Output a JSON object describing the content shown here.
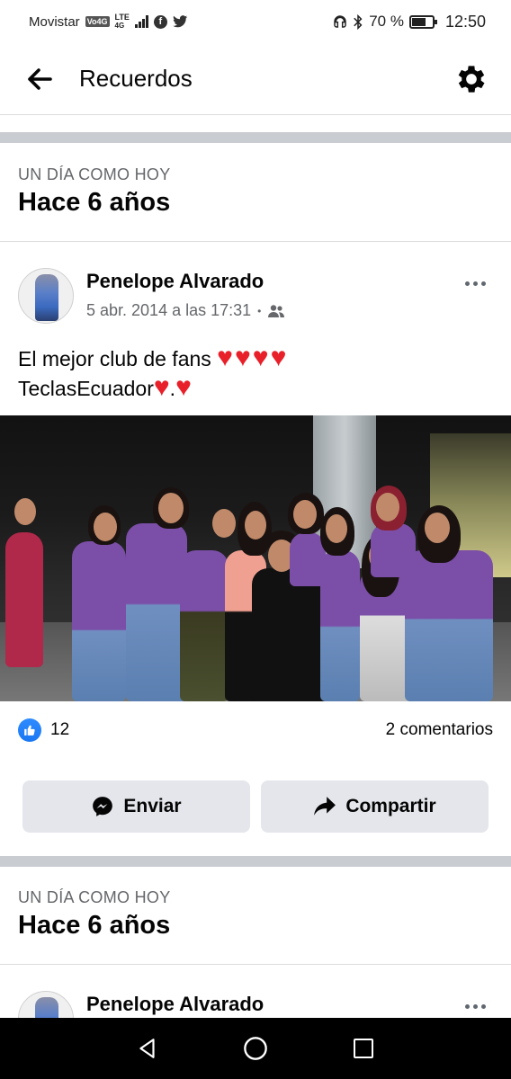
{
  "status_bar": {
    "carrier": "Movistar",
    "volte": "Vo4G",
    "lte_top": "LTE",
    "lte_bottom": "4G",
    "battery_percent_text": "70 %",
    "battery_level": 0.7,
    "time": "12:50",
    "icons": [
      "facebook-icon",
      "twitter-icon",
      "headset-icon",
      "bluetooth-icon",
      "battery-icon"
    ]
  },
  "header": {
    "title": "Recuerdos",
    "back_icon": "back-arrow-icon",
    "settings_icon": "gear-icon"
  },
  "memories": [
    {
      "kicker": "UN DÍA COMO HOY",
      "title": "Hace 6 años",
      "post": {
        "author": "Penelope Alvarado",
        "date": "5 abr. 2014 a las 17:31",
        "separator": "•",
        "audience_icon": "friends-icon",
        "text_line1": "El mejor club de fans",
        "hearts_line1": "♥♥♥♥",
        "text_line2": "TeclasEcuador",
        "heart_a": "♥",
        "dot": ".",
        "heart_b": "♥",
        "likes": "12",
        "comments": "2 comentarios",
        "send_label": "Enviar",
        "share_label": "Compartir"
      }
    },
    {
      "kicker": "UN DÍA COMO HOY",
      "title": "Hace 6 años",
      "post": {
        "author": "Penelope Alvarado"
      }
    }
  ],
  "nav_bar": {
    "back_icon": "nav-back-icon",
    "home_icon": "nav-home-icon",
    "recents_icon": "nav-recents-icon"
  },
  "colors": {
    "accent": "#1877f2",
    "heart": "#e8202a",
    "secondary_text": "#65676b",
    "button_bg": "#e4e6eb",
    "divider": "#c9ccd1"
  }
}
